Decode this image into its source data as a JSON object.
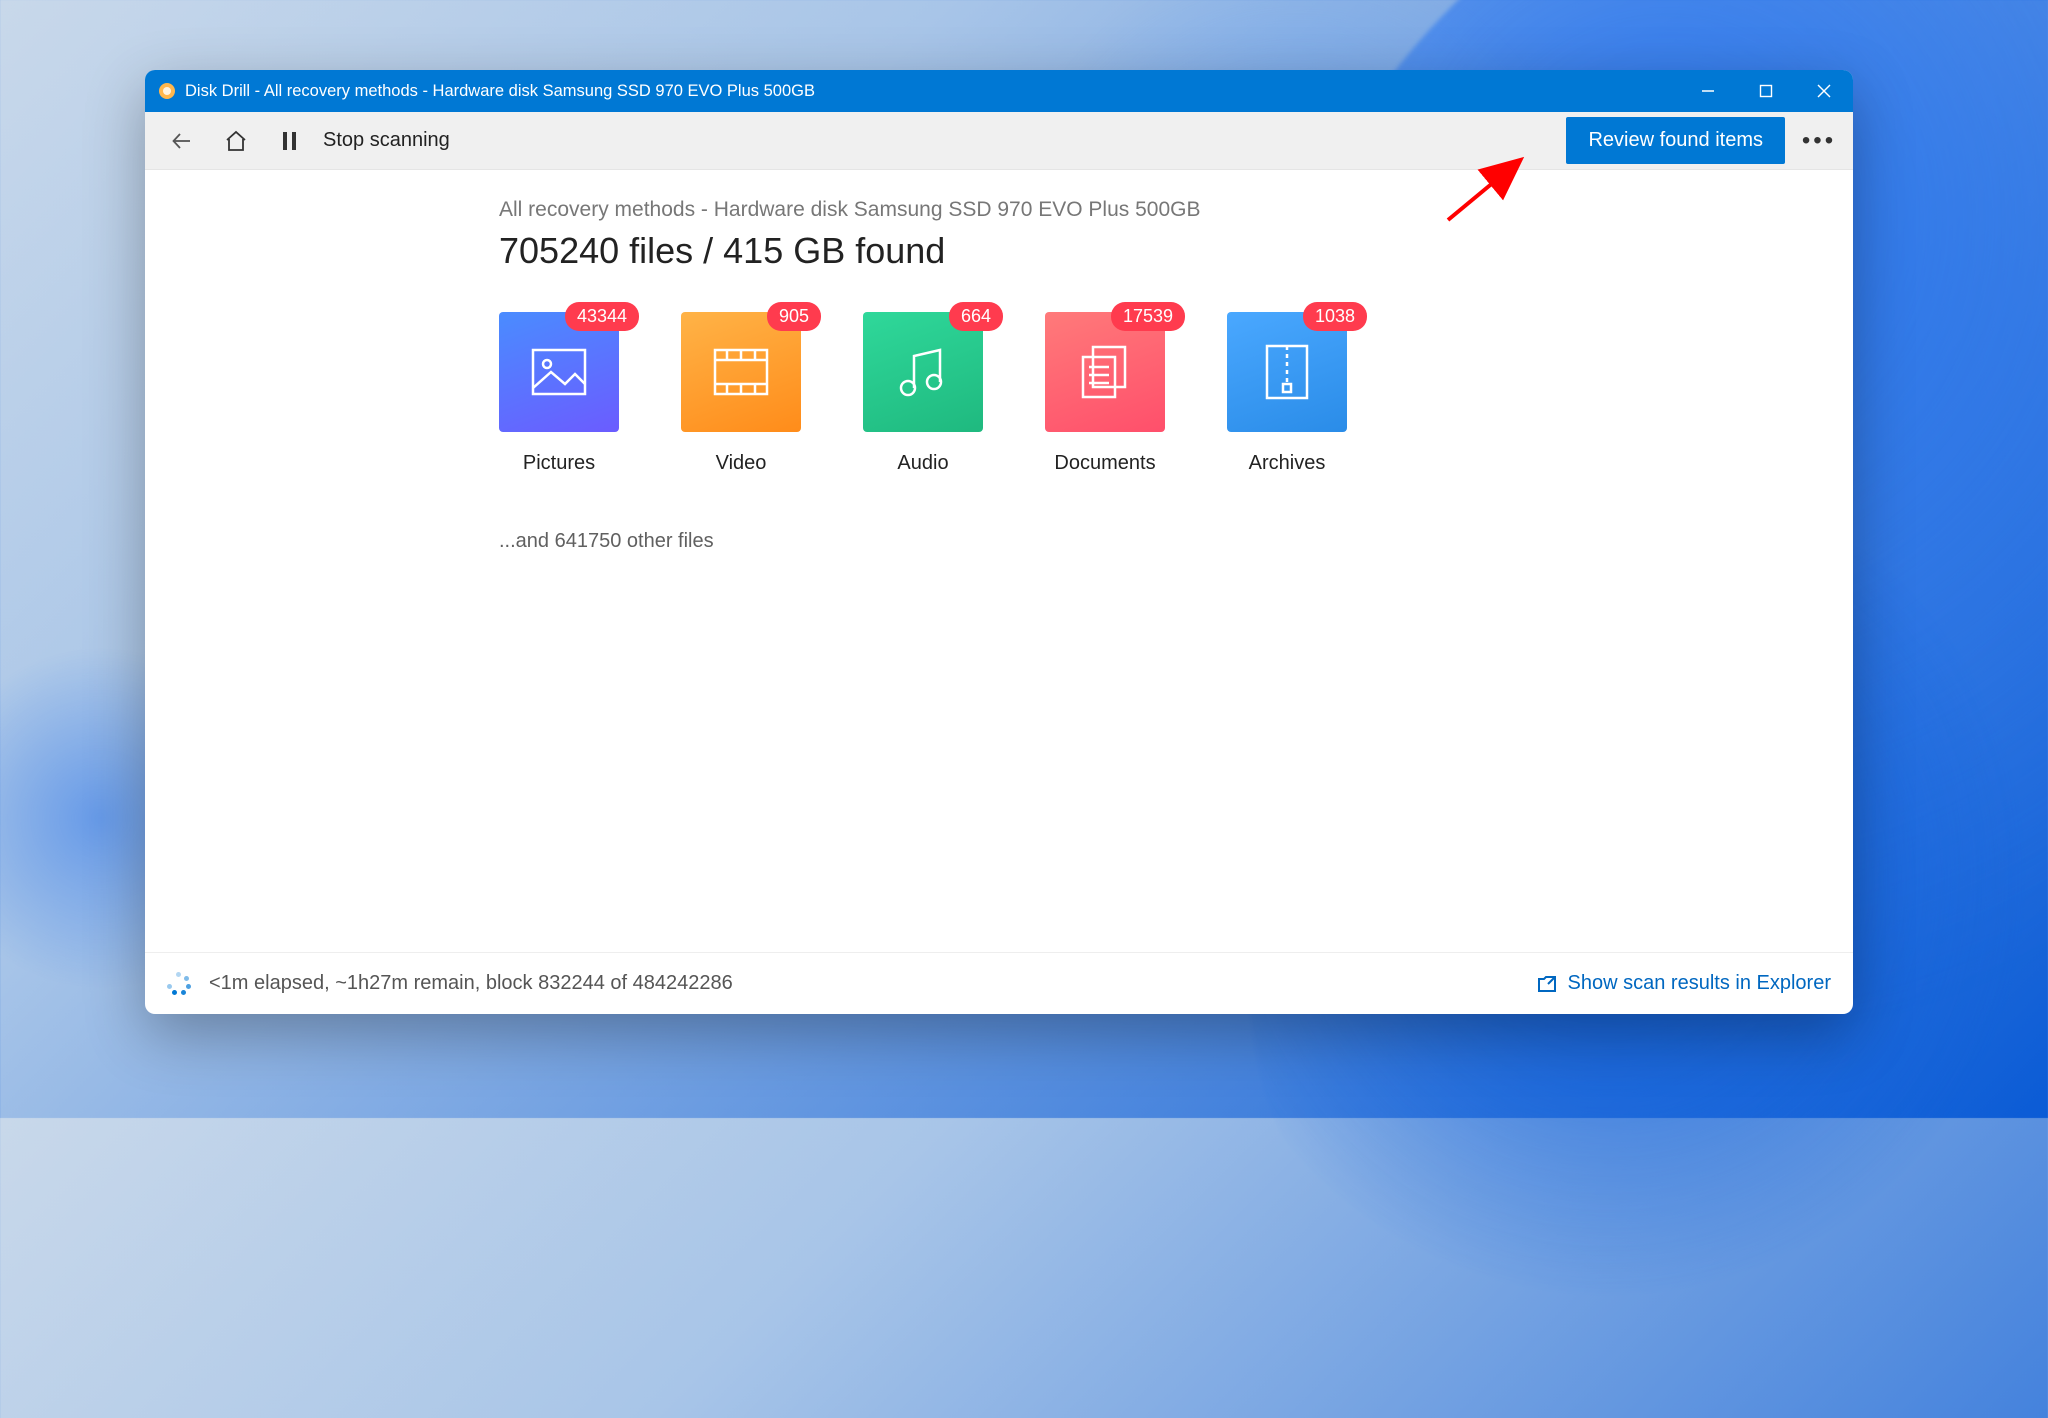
{
  "window": {
    "title": "Disk Drill - All recovery methods - Hardware disk Samsung SSD 970 EVO Plus 500GB"
  },
  "toolbar": {
    "stop_label": "Stop scanning",
    "review_label": "Review found items"
  },
  "main": {
    "breadcrumb": "All recovery methods - Hardware disk Samsung SSD 970 EVO Plus 500GB",
    "headline": "705240 files / 415 GB found",
    "categories": [
      {
        "key": "pictures",
        "label": "Pictures",
        "count": "43344"
      },
      {
        "key": "video",
        "label": "Video",
        "count": "905"
      },
      {
        "key": "audio",
        "label": "Audio",
        "count": "664"
      },
      {
        "key": "documents",
        "label": "Documents",
        "count": "17539"
      },
      {
        "key": "archives",
        "label": "Archives",
        "count": "1038"
      }
    ],
    "other_files": "...and 641750 other files"
  },
  "status": {
    "text": "<1m elapsed, ~1h27m remain, block 832244 of 484242286",
    "explorer_link": "Show scan results in Explorer"
  }
}
